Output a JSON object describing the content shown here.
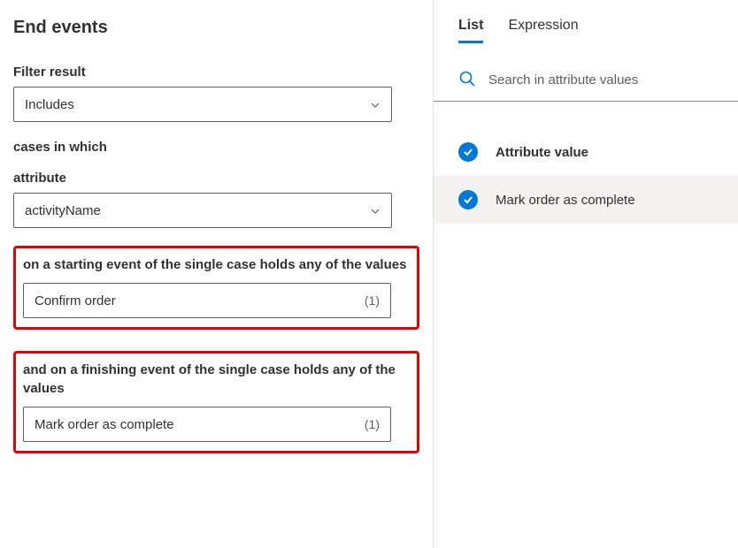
{
  "page_title": "End events",
  "filter_result": {
    "label": "Filter result",
    "value": "Includes"
  },
  "cases_label": "cases in which",
  "attribute": {
    "label": "attribute",
    "value": "activityName"
  },
  "starting_event": {
    "label": "on a starting event of the single case holds any of the values",
    "value": "Confirm order",
    "count": "(1)"
  },
  "finishing_event": {
    "label": "and on a finishing event of the single case holds any of the values",
    "value": "Mark order as complete",
    "count": "(1)"
  },
  "tabs": {
    "list": "List",
    "expression": "Expression"
  },
  "search": {
    "placeholder": "Search in attribute values"
  },
  "attribute_list": {
    "header": "Attribute value",
    "items": [
      {
        "label": "Mark order as complete",
        "selected": true
      }
    ]
  }
}
